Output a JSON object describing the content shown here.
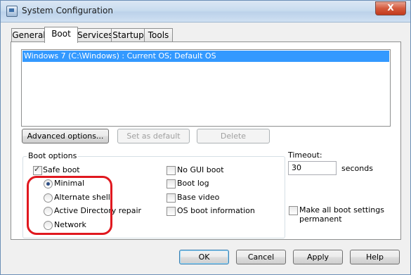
{
  "window": {
    "title": "System Configuration",
    "close_glyph": "X"
  },
  "tabs": [
    {
      "label": "General"
    },
    {
      "label": "Boot"
    },
    {
      "label": "Services"
    },
    {
      "label": "Startup"
    },
    {
      "label": "Tools"
    }
  ],
  "boot_list": {
    "entries": [
      "Windows 7 (C:\\Windows) : Current OS; Default OS"
    ]
  },
  "list_buttons": {
    "advanced": "Advanced options...",
    "set_default": "Set as default",
    "delete": "Delete"
  },
  "boot_options": {
    "group_label": "Boot options",
    "safe_boot": "Safe boot",
    "minimal": "Minimal",
    "alternate_shell": "Alternate shell",
    "ad_repair": "Active Directory repair",
    "network": "Network",
    "no_gui_boot": "No GUI boot",
    "boot_log": "Boot log",
    "base_video": "Base video",
    "os_boot_info": "OS boot information"
  },
  "timeout": {
    "label": "Timeout:",
    "value": "30",
    "unit": "seconds"
  },
  "make_permanent": {
    "line1": "Make all boot settings",
    "line2": "permanent"
  },
  "footer": {
    "ok": "OK",
    "cancel": "Cancel",
    "apply": "Apply",
    "help": "Help"
  },
  "colors": {
    "selection": "#3399ff",
    "highlight_ring": "#e0181f"
  },
  "icons": {
    "app": "system-config-icon",
    "close": "close-icon"
  }
}
